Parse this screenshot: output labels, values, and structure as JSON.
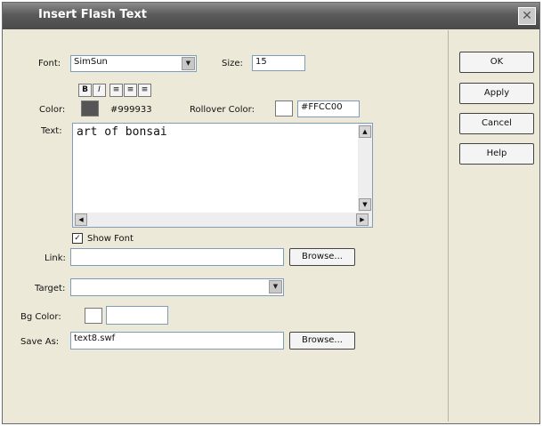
{
  "window": {
    "title": "Insert Flash Text"
  },
  "font": {
    "label": "Font:",
    "value": "SimSun",
    "size_label": "Size:",
    "size_value": "15"
  },
  "format": {
    "bold": "B",
    "italic": "I"
  },
  "color": {
    "label": "Color:",
    "value": "#999933",
    "swatch": "#555555"
  },
  "rollover": {
    "label": "Rollover Color:",
    "value": "#FFCC00",
    "swatch": "#ffffff"
  },
  "text": {
    "label": "Text:",
    "value": "art of bonsai"
  },
  "show_font": {
    "label": "Show Font",
    "checked": true
  },
  "link": {
    "label": "Link:",
    "value": "",
    "browse": "Browse..."
  },
  "target": {
    "label": "Target:",
    "value": ""
  },
  "bg_color": {
    "label": "Bg Color:",
    "value": "",
    "swatch": "#ffffff"
  },
  "save_as": {
    "label": "Save As:",
    "value": "text8.swf",
    "browse": "Browse..."
  },
  "buttons": {
    "ok": "OK",
    "apply": "Apply",
    "cancel": "Cancel",
    "help": "Help"
  }
}
